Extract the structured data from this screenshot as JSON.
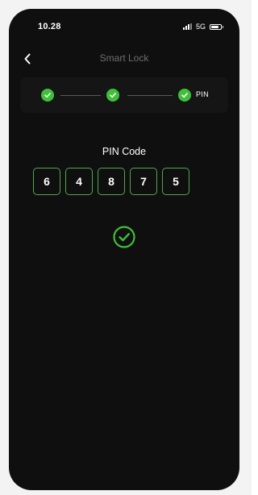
{
  "status_bar": {
    "time": "10.28",
    "network": "5G"
  },
  "header": {
    "title": "Smart Lock",
    "back_icon": "chevron-left-icon"
  },
  "stepper": {
    "steps": [
      {
        "state": "done",
        "label": ""
      },
      {
        "state": "done",
        "label": ""
      },
      {
        "state": "done",
        "label": "PIN"
      }
    ]
  },
  "pin": {
    "title": "PIN Code",
    "digits": [
      "6",
      "4",
      "8",
      "7",
      "5"
    ],
    "status_icon": "check-circle-icon"
  },
  "colors": {
    "background": "#0f0f0f",
    "accent_green": "#3fbf3a",
    "pin_border": "#4fa84a",
    "title_gray": "#6e6e6e"
  }
}
